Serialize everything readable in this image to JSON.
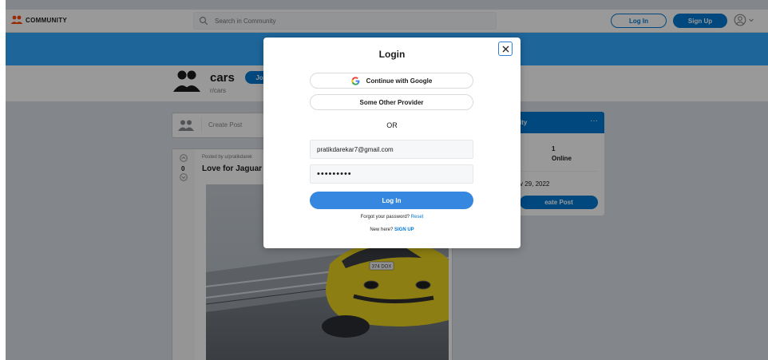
{
  "app": {
    "logo_text": "COMMUNITY"
  },
  "topbar": {
    "search_placeholder": "Search in Community",
    "login_label": "Log In",
    "signup_label": "Sign Up"
  },
  "community": {
    "name": "cars",
    "subname": "r/cars",
    "join_label": "Jo"
  },
  "feed": {
    "create_post_placeholder": "Create Post",
    "post": {
      "posted_by": "Posted by u/pratikdarek",
      "title": "Love for Jaguar is",
      "vote_count": "0",
      "plate_text": "374 DOX"
    }
  },
  "sidebar": {
    "title": "ity",
    "dots": "···",
    "online_count": "1",
    "online_label": "Online",
    "created": "v 29, 2022",
    "create_post_label": "eate Post"
  },
  "modal": {
    "title": "Login",
    "google_label": "Continue with Google",
    "other_label": "Some Other Provider",
    "or_text": "OR",
    "email_value": "pratikdarekar7@gmail.com",
    "password_value": "•••••••••",
    "login_label": "Log In",
    "forgot_text": "Forgot your password?",
    "reset_link": "Reset",
    "new_here_text": "New here?",
    "signup_link": "SIGN UP"
  },
  "colors": {
    "primary": "#0079d3",
    "banner": "#33a8ff",
    "page_bg": "#dae0e6"
  }
}
